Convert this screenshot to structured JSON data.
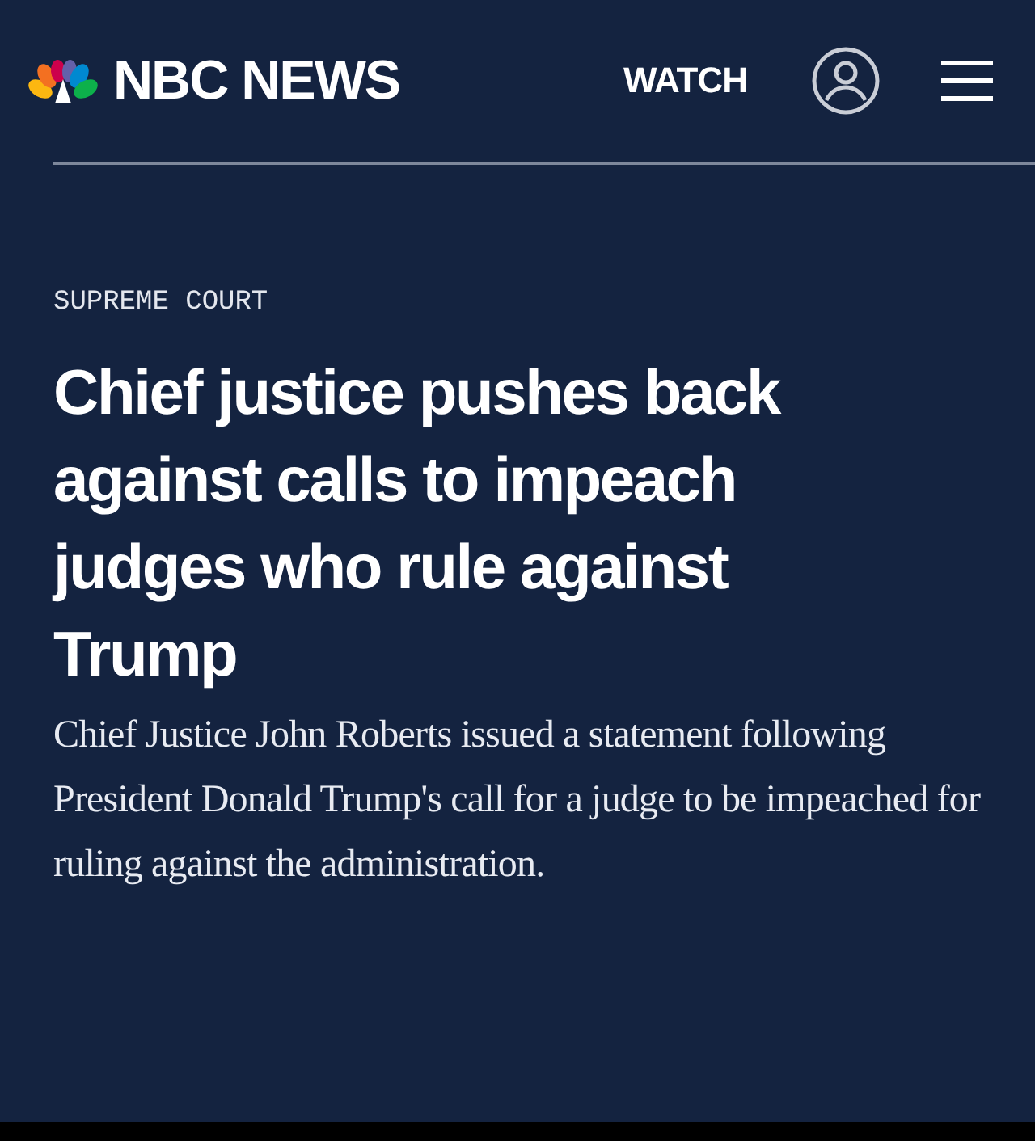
{
  "header": {
    "logo_text": "NBC NEWS",
    "watch_label": "WATCH"
  },
  "article": {
    "category": "SUPREME COURT",
    "headline": "Chief justice pushes back against calls to impeach judges who rule against Trump",
    "summary": "Chief Justice John Roberts issued a statement following President Donald Trump's call for a judge to be impeached for ruling against the administration."
  }
}
